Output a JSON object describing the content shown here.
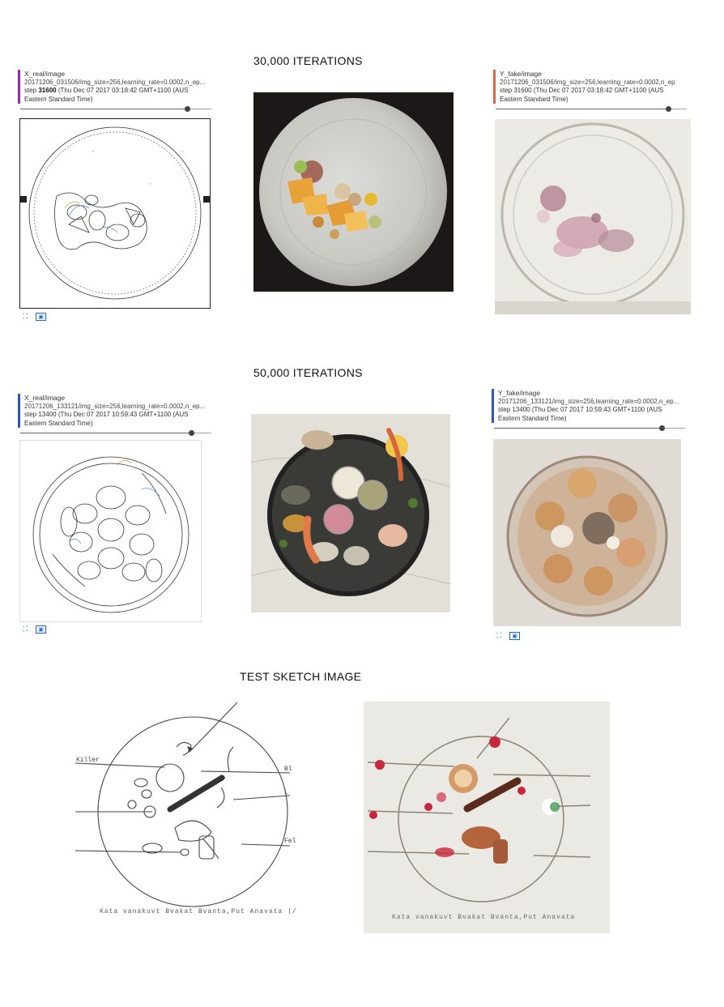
{
  "sections": [
    {
      "title": "30,000 ITERATIONS"
    },
    {
      "title": "50,000 ITERATIONS"
    },
    {
      "title": "TEST SKETCH IMAGE"
    }
  ],
  "cards": [
    {
      "tag": "X_real/image",
      "run": "20171206_031506/img_size=256,learning_rate=0.0002,n_ep...",
      "step_label": "step",
      "step": "31600",
      "time": "(Thu Dec 07 2017 03:18:42 GMT+1100 (AUS Eastern Standard Time)",
      "accent": "#9c27b0"
    },
    {
      "tag": "Y_fake/image",
      "run": "20171206_031506/img_size=256,learning_rate=0.0002,n_ep",
      "step_label": "step",
      "step": "31600",
      "time": "(Thu Dec 07 2017 03:18:42 GMT+1100 (AUS Eastern Standard Time)",
      "accent": "#e8643c"
    },
    {
      "tag": "X_real/image",
      "run": "20171206_133121/img_size=256,learning_rate=0.0002,n_ep...",
      "step_label": "step",
      "step": "13400",
      "time": "(Thu Dec 07 2017 10:59:43 GMT+1100 (AUS Eastern Standard Time)",
      "accent": "#2c57b5"
    },
    {
      "tag": "Y_fake/image",
      "run": "20171206_133121/img_size=256,learning_rate=0.0002,n_ep...",
      "step_label": "step",
      "step": "13400",
      "time": "(Thu Dec 07 2017 10:59:43 GMT+1100 (AUS Eastern Standard Time)",
      "accent": "#2c57b5"
    }
  ],
  "icons": {
    "expand": "expand-icon",
    "image": "image-icon"
  },
  "sketch_caption": "Kata vanakuvt  Bvakat  Bvanta,Put Anavata"
}
